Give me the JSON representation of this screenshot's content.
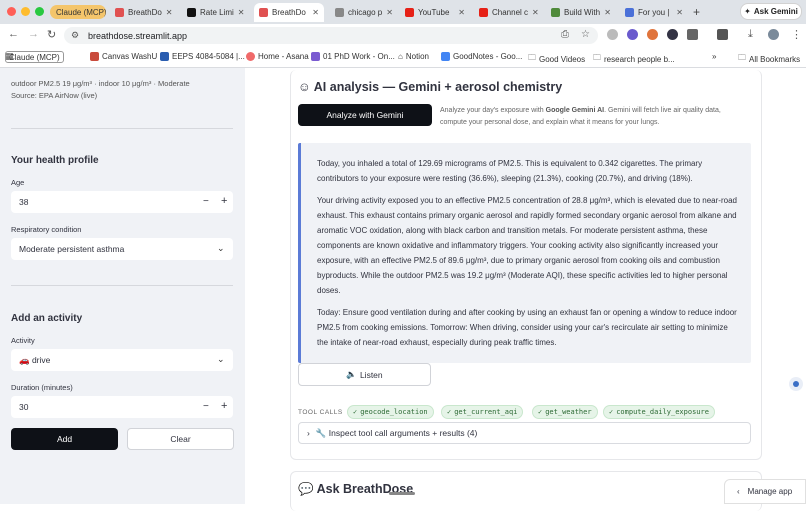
{
  "browser": {
    "tabs": [
      {
        "label": "Claude (MCP)",
        "color": "#d2a23d"
      },
      {
        "label": "BreathDo",
        "color": "#e05151"
      },
      {
        "label": "Rate Limi",
        "color": "#111111"
      },
      {
        "label": "BreathDo",
        "color": "#e05151"
      },
      {
        "label": "chicago p",
        "color": "#888888"
      },
      {
        "label": "YouTube",
        "color": "#e62117"
      },
      {
        "label": "Channel c",
        "color": "#e62117"
      },
      {
        "label": "Build With",
        "color": "#4f8a3b"
      },
      {
        "label": "For you | ",
        "color": "#4a70d8"
      }
    ],
    "ask_gemini": "Ask Gemini",
    "url": "breathdose.streamlit.app",
    "bookmarks": [
      "Claude (MCP)",
      "Canvas WashU",
      "EEPS 4084-5084 |...",
      "Home - Asana",
      "01 PhD Work - On...",
      "Notion",
      "GoodNotes - Goo...",
      "Good Videos",
      "research people b...",
      "All Bookmarks"
    ]
  },
  "sidebar": {
    "aq_line": "outdoor PM2.5 19 μg/m³ · indoor 10 μg/m³ · Moderate",
    "source": "Source: EPA AirNow (live)",
    "health_heading": "Your health profile",
    "age_label": "Age",
    "age_value": "38",
    "resp_label": "Respiratory condition",
    "resp_value": "Moderate persistent asthma",
    "activity_heading": "Add an activity",
    "activity_label": "Activity",
    "activity_value": "🚗 drive",
    "duration_label": "Duration (minutes)",
    "duration_value": "30",
    "add_label": "Add",
    "clear_label": "Clear"
  },
  "main": {
    "ai_heading": "AI analysis — Gemini + aerosol chemistry",
    "gemini_button": "Analyze with Gemini",
    "caption_pre": "Analyze your day's exposure with ",
    "caption_bold": "Google Gemini AI",
    "caption_post": ". Gemini will fetch live air quality data, compute your personal dose, and explain what it means for your lungs.",
    "report": [
      "Today, you inhaled a total of 129.69 micrograms of PM2.5. This is equivalent to 0.342 cigarettes. The primary contributors to your exposure were resting (36.6%), sleeping (21.3%), cooking (20.7%), and driving (18%).",
      "Your driving activity exposed you to an effective PM2.5 concentration of 28.8 μg/m³, which is elevated due to near-road exhaust. This exhaust contains primary organic aerosol and rapidly formed secondary organic aerosol from alkane and aromatic VOC oxidation, along with black carbon and transition metals. For moderate persistent asthma, these components are known oxidative and inflammatory triggers. Your cooking activity also significantly increased your exposure, with an effective PM2.5 of 89.6 μg/m³, due to primary organic aerosol from cooking oils and combustion byproducts. While the outdoor PM2.5 was 19.2 μg/m³ (Moderate AQI), these specific activities led to higher personal doses.",
      "Today: Ensure good ventilation during and after cooking by using an exhaust fan or opening a window to reduce indoor PM2.5 from cooking emissions. Tomorrow: When driving, consider using your car's recirculate air setting to minimize the intake of near-road exhaust, especially during peak traffic times."
    ],
    "listen_label": "Listen",
    "tool_calls_label": "TOOL CALLS",
    "tool_calls": [
      "geocode_location",
      "get_current_aqi",
      "get_weather",
      "compute_daily_exposure"
    ],
    "expander_label": "🔧 Inspect tool call arguments + results (4)",
    "ask_heading": "Ask BreathDose",
    "manage_app": "Manage app"
  }
}
